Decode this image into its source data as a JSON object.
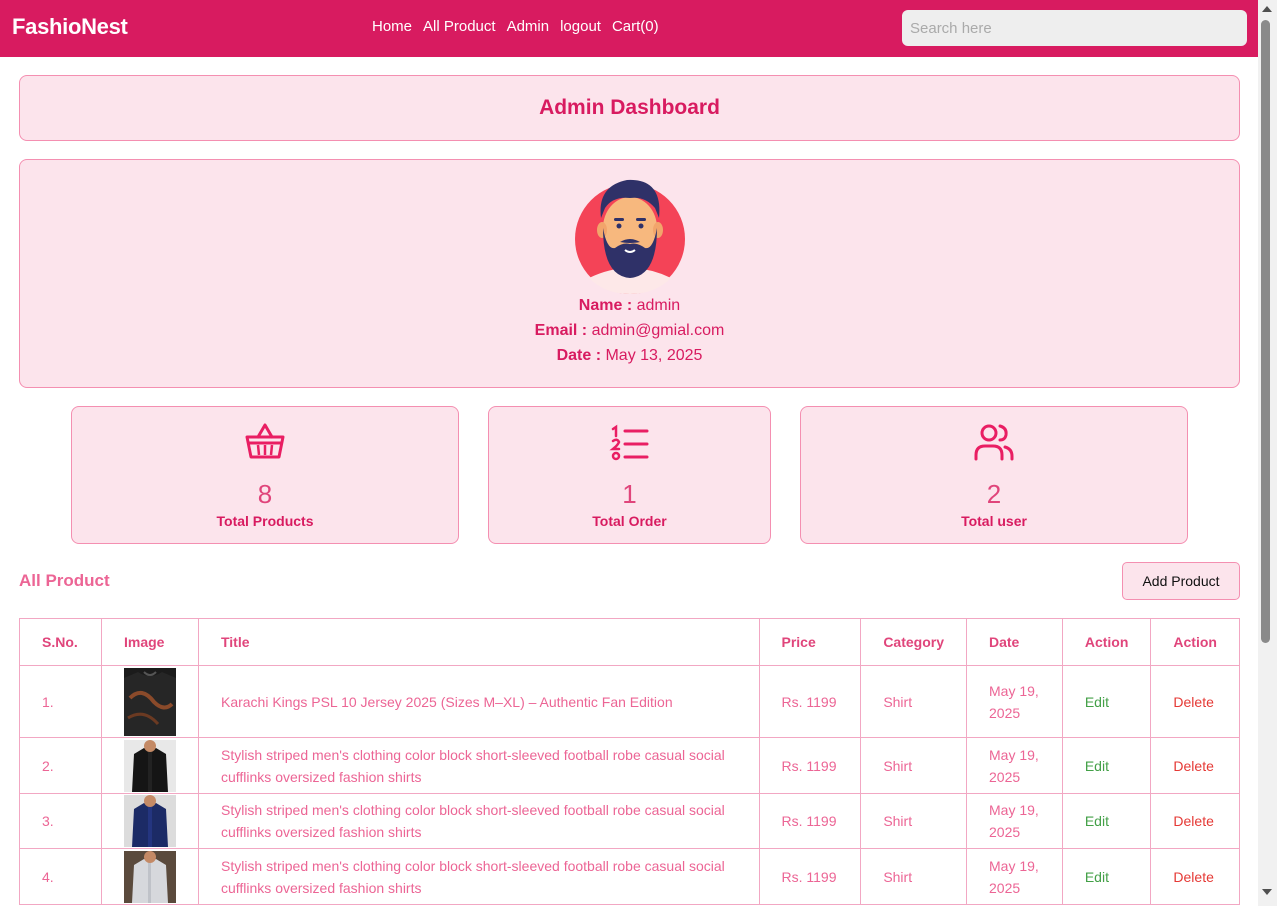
{
  "navbar": {
    "brand": "FashioNest",
    "links": [
      "Home",
      "All Product",
      "Admin",
      "logout",
      "Cart(0)"
    ],
    "search_placeholder": "Search here"
  },
  "dashboard": {
    "title": "Admin Dashboard"
  },
  "profile": {
    "name_label": "Name :",
    "name_value": " admin",
    "email_label": "Email :",
    "email_value": " admin@gmial.com",
    "date_label": "Date :",
    "date_value": " May 13, 2025"
  },
  "stats": [
    {
      "icon": "basket-icon",
      "value": "8",
      "label": "Total Products"
    },
    {
      "icon": "list-icon",
      "value": "1",
      "label": "Total Order"
    },
    {
      "icon": "users-icon",
      "value": "2",
      "label": "Total user"
    }
  ],
  "products": {
    "section_title": "All Product",
    "add_button": "Add Product",
    "columns": [
      "S.No.",
      "Image",
      "Title",
      "Price",
      "Category",
      "Date",
      "Action",
      "Action"
    ],
    "rows": [
      {
        "sno": "1.",
        "title": "Karachi Kings PSL 10 Jersey 2025 (Sizes M–XL) – Authentic Fan Edition",
        "price": "Rs. 1199",
        "category": "Shirt",
        "date": "May 19, 2025",
        "edit": "Edit",
        "delete": "Delete"
      },
      {
        "sno": "2.",
        "title": "Stylish striped men's clothing color block short-sleeved football robe casual social cufflinks oversized fashion shirts",
        "price": "Rs. 1199",
        "category": "Shirt",
        "date": "May 19, 2025",
        "edit": "Edit",
        "delete": "Delete"
      },
      {
        "sno": "3.",
        "title": "Stylish striped men's clothing color block short-sleeved football robe casual social cufflinks oversized fashion shirts",
        "price": "Rs. 1199",
        "category": "Shirt",
        "date": "May 19, 2025",
        "edit": "Edit",
        "delete": "Delete"
      },
      {
        "sno": "4.",
        "title": "Stylish striped men's clothing color block short-sleeved football robe casual social cufflinks oversized fashion shirts",
        "price": "Rs. 1199",
        "category": "Shirt",
        "date": "May 19, 2025",
        "edit": "Edit",
        "delete": "Delete"
      }
    ]
  },
  "colors": {
    "primary": "#d81b60",
    "panel": "#fce4ec",
    "border": "#f48fb1",
    "edit": "#43a047",
    "delete": "#e53935"
  }
}
